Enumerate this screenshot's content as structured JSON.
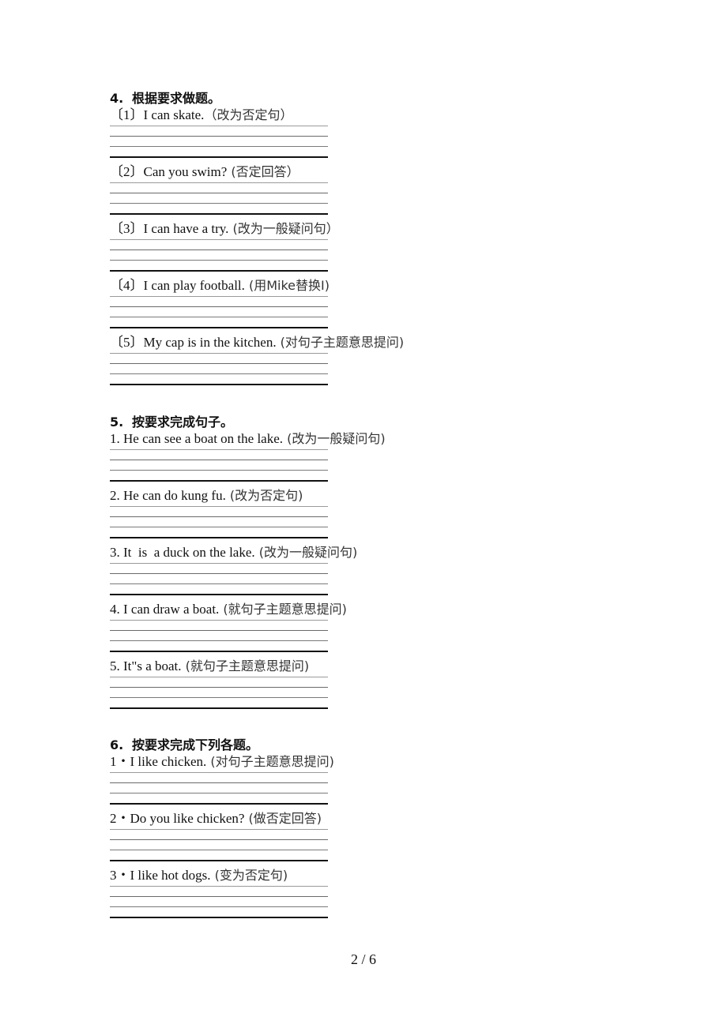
{
  "sections": [
    {
      "number": "4.",
      "title": "根据要求做题。",
      "questions": [
        {
          "label": "〔1〕I can skate.",
          "hint": "（改为否定句）"
        },
        {
          "label": "〔2〕Can you swim?",
          "hint": " (否定回答）"
        },
        {
          "label": "〔3〕I can have a try.",
          "hint": " (改为一般疑问句）"
        },
        {
          "label": "〔4〕I can play football.",
          "hint": " (用Mike替换I)"
        },
        {
          "label": "〔5〕My cap is in the kitchen.",
          "hint": " (对句子主题意思提问)"
        }
      ]
    },
    {
      "number": "5.",
      "title": "按要求完成句子。",
      "questions": [
        {
          "label": "1. He can see a boat on the lake.",
          "hint": " (改为一般疑问句)"
        },
        {
          "label": "2. He can do kung fu.",
          "hint": " (改为否定句)"
        },
        {
          "label": "3. It  is  a duck on the lake.",
          "hint": " (改为一般疑问句)"
        },
        {
          "label": "4. I can draw a boat.",
          "hint": " (就句子主题意思提问)"
        },
        {
          "label": "5. It\"s a boat.",
          "hint": " (就句子主题意思提问)"
        }
      ]
    },
    {
      "number": "6.",
      "title": "按要求完成下列各题。",
      "questions": [
        {
          "label": "1・I like chicken.",
          "hint": " (对句子主题意思提问)"
        },
        {
          "label": "2・Do you like chicken?",
          "hint": " (做否定回答)"
        },
        {
          "label": "3・I like hot dogs.",
          "hint": " (变为否定句)"
        }
      ]
    }
  ],
  "footer": {
    "page_indicator": "2 / 6"
  }
}
